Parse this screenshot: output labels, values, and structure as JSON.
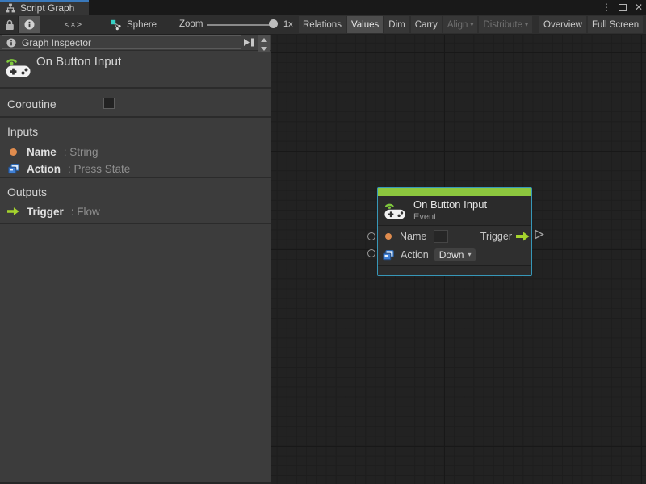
{
  "window": {
    "tab_title": "Script Graph"
  },
  "icons": {
    "kebab": "⋮",
    "close": "✕",
    "caret": "▾"
  },
  "toolbar": {
    "code_icon": "<×>",
    "sphere_label": "Sphere",
    "zoom_label": "Zoom",
    "zoom_value": "1x",
    "buttons": [
      {
        "label": "Relations",
        "state": "normal"
      },
      {
        "label": "Values",
        "state": "selected"
      },
      {
        "label": "Dim",
        "state": "normal"
      },
      {
        "label": "Carry",
        "state": "normal"
      },
      {
        "label": "Align",
        "state": "disabled",
        "has_caret": true
      },
      {
        "label": "Distribute",
        "state": "disabled",
        "has_caret": true
      },
      {
        "label": "Overview",
        "state": "normal"
      },
      {
        "label": "Full Screen",
        "state": "normal"
      }
    ]
  },
  "inspector": {
    "header_title": "Graph Inspector",
    "unit_title": "On Button Input",
    "coroutine_label": "Coroutine",
    "coroutine_checked": false,
    "inputs_title": "Inputs",
    "input_rows": [
      {
        "name": "Name",
        "type": ": String",
        "icon": "string-port"
      },
      {
        "name": "Action",
        "type": ": Press State",
        "icon": "object-port"
      }
    ],
    "outputs_title": "Outputs",
    "output_rows": [
      {
        "name": "Trigger",
        "type": ": Flow",
        "icon": "flow-port"
      }
    ]
  },
  "node": {
    "title": "On Button Input",
    "subtitle": "Event",
    "name_port_label": "Name",
    "action_port_label": "Action",
    "action_value": "Down",
    "trigger_port_label": "Trigger",
    "accent_color": "#8CC63E",
    "selection_color": "#3797B8"
  },
  "colors": {
    "canvas_bg": "#222222",
    "panel_bg": "#3C3C3C",
    "string_port": "#E08C4E",
    "flow_port": "#A5D42D",
    "object_port": "#3F7FD4"
  }
}
